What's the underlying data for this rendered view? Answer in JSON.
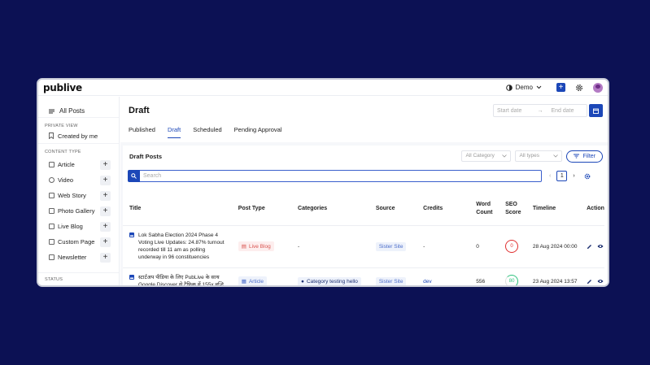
{
  "app": {
    "logo": "publive",
    "workspace": "Demo"
  },
  "sidebar": {
    "all_posts": "All Posts",
    "private_view_title": "PRIVATE VIEW",
    "created_by_me": "Created by me",
    "content_type_title": "CONTENT TYPE",
    "items": [
      {
        "label": "Article",
        "icon": "article-icon"
      },
      {
        "label": "Video",
        "icon": "video-icon"
      },
      {
        "label": "Web Story",
        "icon": "web-story-icon"
      },
      {
        "label": "Photo Gallery",
        "icon": "photo-gallery-icon"
      },
      {
        "label": "Live Blog",
        "icon": "live-blog-icon"
      },
      {
        "label": "Custom Page",
        "icon": "custom-page-icon"
      },
      {
        "label": "Newsletter",
        "icon": "newsletter-icon"
      }
    ],
    "status_title": "STATUS",
    "add_symbol": "+"
  },
  "header": {
    "title": "Draft",
    "tabs": [
      "Published",
      "Draft",
      "Scheduled",
      "Pending Approval"
    ],
    "start_placeholder": "Start date",
    "end_placeholder": "End date",
    "arrow": "→"
  },
  "panel": {
    "title": "Draft Posts",
    "category_select": "All Category",
    "type_select": "All types",
    "filter_label": "Filter",
    "search_placeholder": "Search",
    "page": "1",
    "prev": "‹",
    "next": "›"
  },
  "table": {
    "columns": [
      "Title",
      "Post Type",
      "Categories",
      "Source",
      "Credits",
      "Word Count",
      "SEO Score",
      "Timeline",
      "Action"
    ],
    "rows": [
      {
        "title": "Lok Sabha Election 2024 Phase 4 Voting Live Updates: 24.87% turnout recorded till 11 am as polling underway in 96 constituencies",
        "post_type": "Live Blog",
        "category": "-",
        "source": "Sister Site",
        "credits": "-",
        "word_count": "0",
        "seo_score": "0",
        "timeline": "28 Aug 2024 00:00"
      },
      {
        "title": "स्टार्टअप पीडिया के लिए PubLive के साथ Google Discover से ट्रैफिक में 155x वृद्धि",
        "post_type": "Article",
        "category": "Category testing hello",
        "source": "Sister Site",
        "credits": "dev",
        "word_count": "556",
        "seo_score": "80",
        "timeline": "23 Aug 2024 13:57"
      }
    ]
  },
  "colors": {
    "background": "#0c1154",
    "accent": "#1c47b8",
    "danger": "#e03030",
    "success": "#2ec27e"
  }
}
